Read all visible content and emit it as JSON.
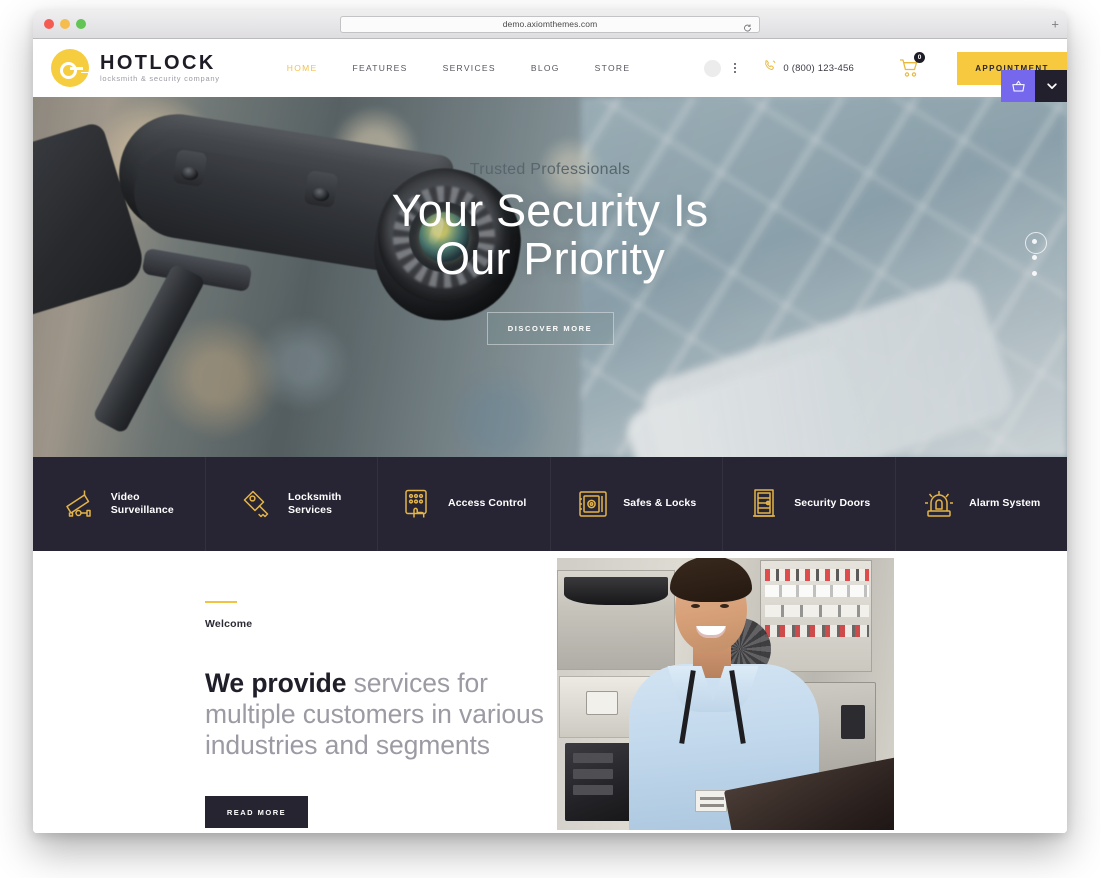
{
  "browser": {
    "url": "demo.axiomthemes.com",
    "reload_icon": "reload-icon",
    "new_tab_label": "+"
  },
  "header": {
    "logo_title": "HOTLOCK",
    "logo_tagline": "locksmith & security company",
    "nav": [
      {
        "label": "HOME",
        "active": true
      },
      {
        "label": "FEATURES",
        "active": false
      },
      {
        "label": "SERVICES",
        "active": false
      },
      {
        "label": "BLOG",
        "active": false
      },
      {
        "label": "STORE",
        "active": false
      }
    ],
    "phone": "0 (800) 123-456",
    "cart_count": "0",
    "appointment_label": "APPOINTMENT",
    "accent_color": "#f6c93f",
    "widget_purple_color": "#7668ec",
    "widget_dark_color": "#21202c"
  },
  "hero": {
    "subtitle": "Trusted Professionals",
    "title_line1": "Your Security Is",
    "title_line2": "Our Priority",
    "button_label": "DISCOVER MORE",
    "slides_total": 3,
    "active_slide": 1
  },
  "services": [
    {
      "icon": "cctv-camera-icon",
      "line1": "Video",
      "line2": "Surveillance"
    },
    {
      "icon": "key-lock-icon",
      "line1": "Locksmith",
      "line2": "Services"
    },
    {
      "icon": "keypad-hand-icon",
      "line1": "Access Control",
      "line2": ""
    },
    {
      "icon": "safe-box-icon",
      "line1": "Safes & Locks",
      "line2": ""
    },
    {
      "icon": "security-door-icon",
      "line1": "Security Doors",
      "line2": ""
    },
    {
      "icon": "alarm-siren-icon",
      "line1": "Alarm System",
      "line2": ""
    }
  ],
  "welcome": {
    "label": "Welcome",
    "heading_bold": "We provide",
    "heading_rest": " services for multiple customers in various industries and segments",
    "button_label": "READ MORE",
    "accent_color": "#f2c341"
  }
}
